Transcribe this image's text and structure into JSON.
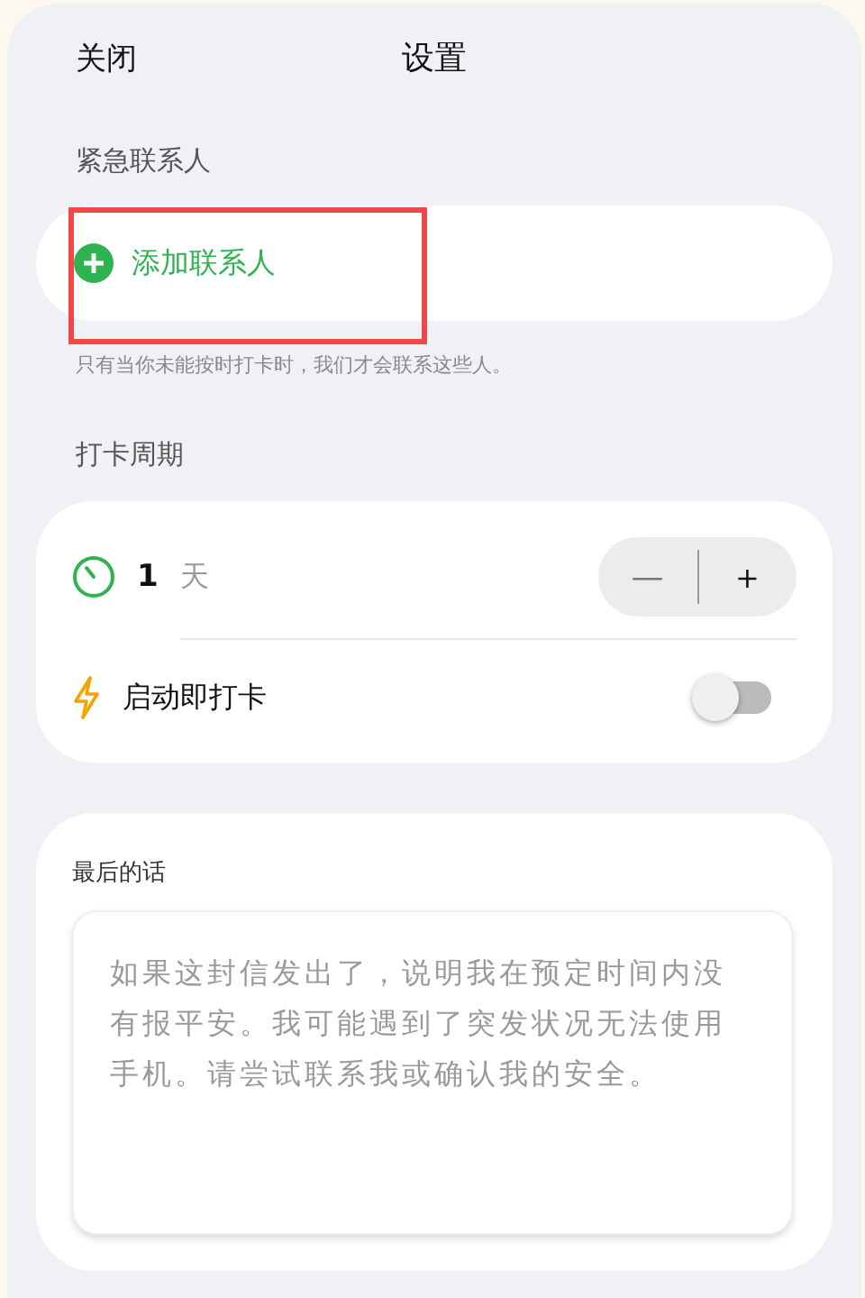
{
  "header": {
    "close": "关闭",
    "title": "设置"
  },
  "contacts": {
    "label": "紧急联系人",
    "add_button": {
      "label": "添加联系人",
      "highlighted": true
    },
    "hint": "只有当你未能按时打卡时，我们才会联系这些人。"
  },
  "checkin": {
    "label": "打卡周期",
    "period": {
      "value": "1",
      "unit": "天",
      "minus": "—",
      "plus": "+"
    },
    "instant": {
      "label": "启动即打卡",
      "on": false
    }
  },
  "last_words": {
    "label": "最后的话",
    "placeholder": "如果这封信发出了，说明我在预定时间内没有报平安。我可能遇到了突发状况无法使用手机。请尝试联系我或确认我的安全。"
  }
}
